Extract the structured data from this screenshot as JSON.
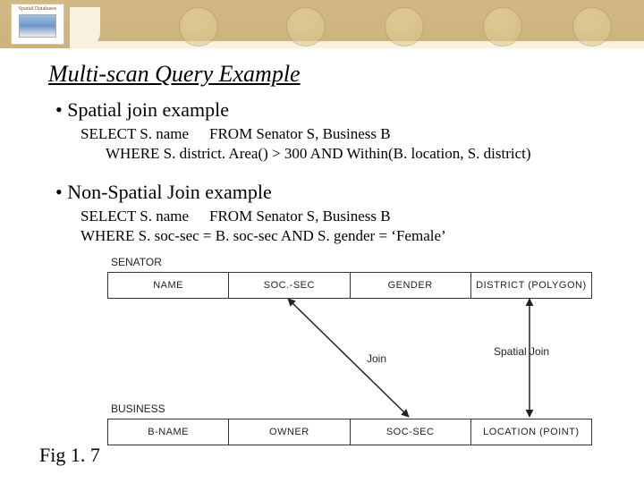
{
  "title": "Multi-scan Query Example",
  "bullets": {
    "b1": "• Spatial join example",
    "b2": "• Non-Spatial Join example"
  },
  "code": {
    "c1a": "SELECT S. name",
    "c1b": "FROM Senator S, Business B",
    "c2": "WHERE S. district. Area() > 300 AND Within(B. location, S. district)",
    "c3a": "SELECT S. name",
    "c3b": "FROM Senator S, Business B",
    "c4": "WHERE S. soc-sec = B. soc-sec AND S. gender = ‘Female’"
  },
  "diagram": {
    "senator_label": "SENATOR",
    "business_label": "BUSINESS",
    "join_label": "Join",
    "spatial_join_label": "Spatial Join",
    "senator_cols": [
      "NAME",
      "SOC.-SEC",
      "GENDER",
      "DISTRICT (POLYGON)"
    ],
    "business_cols": [
      "B-NAME",
      "OWNER",
      "SOC-SEC",
      "LOCATION (POINT)"
    ]
  },
  "fig_caption": "Fig 1. 7",
  "banner": {
    "logo_line": "Spatial Databases"
  }
}
